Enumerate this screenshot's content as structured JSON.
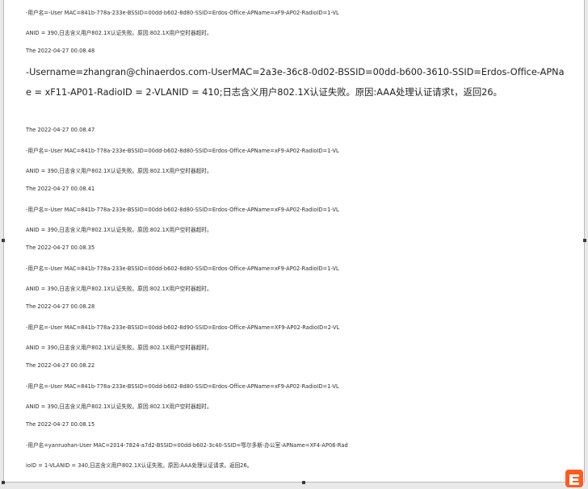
{
  "document": {
    "lines": [
      "-用户名=-User MAC=841b-778a-233e-BSSID=00dd-b602-8d80-SSID=Erdos-Office-APName=xF9-AP02-RadioID=1-VL",
      "ANID = 390,日志含义用户802.1X认证失败。原因:802.1X用户空时器超时。",
      "The 2022-04-27 00.08.48",
      "The 2022-04-27 00.08.47",
      "-用户名=-User MAC=841b-778a-233e-BSSID=00dd-b602-8d80-SSID=Erdos-Office-APName=xF9-AP02-RadioID=1-VL",
      "ANID = 390,日志含义用户802.1X认证失败。原因:802.1X用户空时器超时。",
      "The 2022-04-27 00.08.41",
      "-用户名=-User MAC=841b-778a-233e-BSSID=00dd-b602-8d80-SSID=Erdos-Office-APName=xF9-AP02-RadioID=1-VL",
      "ANID = 390,日志含义用户802.1X认证失败。原因:802.1X用户空时器超时。",
      "The 2022-04-27 00.08.35",
      "-用户名=-User MAC=841b-778a-233e-BSSID=00dd-b602-8d80-SSID=Erdos-Office-APName=xF9-AP02-RadioID=1-VL",
      "ANID = 390,日志含义用户802.1X认证失败。原因:802.1X用户空时器超时。",
      "The 2022-04-27 00.08.28",
      "-用户名=-User MAC=841b-778a-233e-BSSID=00dd-b602-8d90-SSID=Erdos-Office-APName=XF9-AP02-RadioID=2-VL",
      "ANID = 390,日志含义用户802.1X认证失败。原因:802.1X用户空时器超时。",
      "The 2022-04-27 00.08.22",
      "-用户名=-User MAC=841b-778a-233e-BSSID=00dd-b602-8d80-SSID=Erdos-Office-APName=xF9-AP02-RadioID=1-VL",
      "ANID = 390,日志含义用户802.1X认证失败。原因:802.1X用户空时器超时。",
      "The 2022-04-27 00.08.15",
      "-用户名=yanruohan-User MAC=2014-7824-a7d2-BSSID=00dd-b602-3c40-SSID=鄂尔多斯-办公室-APName=XF4-AP06-Rad",
      "ioID = 1-VLANID = 340,日志含义用户802.1X认证失败。原因:AAA处理认证请求。返回26。"
    ],
    "highlight": {
      "line1": "-Username=zhangran@chinaerdos.com-UserMAC=2a3e-36c8-0d02-BSSID=00dd-b600-3610-SSID=Erdos-Office-APNa",
      "line2": "e = xF11-AP01-RadioID = 2-VLANID = 410;日志含义用户802.1X认证失败。原因:AAA处理认证请求t，返回26。"
    }
  },
  "logo": {
    "icon": "logo-icon",
    "color": "#ff5a1f"
  }
}
